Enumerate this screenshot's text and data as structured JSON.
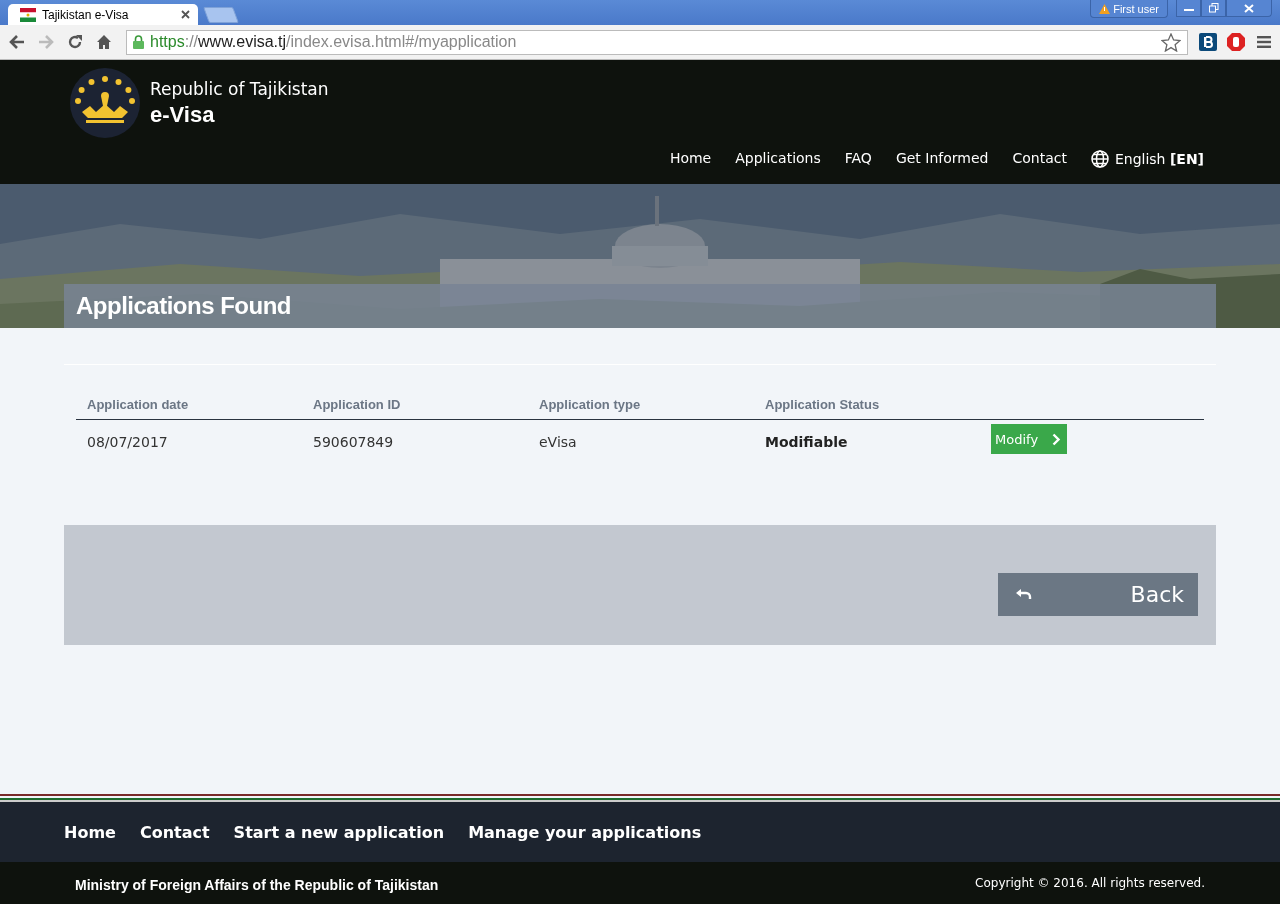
{
  "browser": {
    "tab": {
      "title": "Tajikistan e-Visa"
    },
    "profile": "First user",
    "address": [
      {
        "text": "https",
        "kind": "scheme"
      },
      {
        "text": "://",
        "kind": "dim"
      },
      {
        "text": "www.evisa.tj",
        "kind": "host"
      },
      {
        "text": "/index.evisa.html#/myapplication",
        "kind": "dim"
      }
    ]
  },
  "header": {
    "subtitle": "Republic of Tajikistan",
    "title": "e-Visa",
    "nav": [
      {
        "label": "Home"
      },
      {
        "label": "Applications"
      },
      {
        "label": "FAQ"
      },
      {
        "label": "Get Informed"
      },
      {
        "label": "Contact"
      }
    ],
    "language": {
      "label": "English",
      "code": "[EN]"
    }
  },
  "page_title": "Applications Found",
  "table": {
    "columns": [
      "Application date",
      "Application ID",
      "Application type",
      "Application Status"
    ],
    "rows": [
      {
        "cells": [
          "08/07/2017",
          "590607849",
          "eVisa",
          "Modifiable"
        ],
        "action": "Modify"
      }
    ]
  },
  "back_button": "Back",
  "footer": {
    "links": [
      "Home",
      "Contact",
      "Start a new application",
      "Manage your applications"
    ],
    "ministry": "Ministry of Foreign Affairs of the Republic of Tajikistan",
    "copyright": "Copyright © 2016. All rights reserved."
  }
}
